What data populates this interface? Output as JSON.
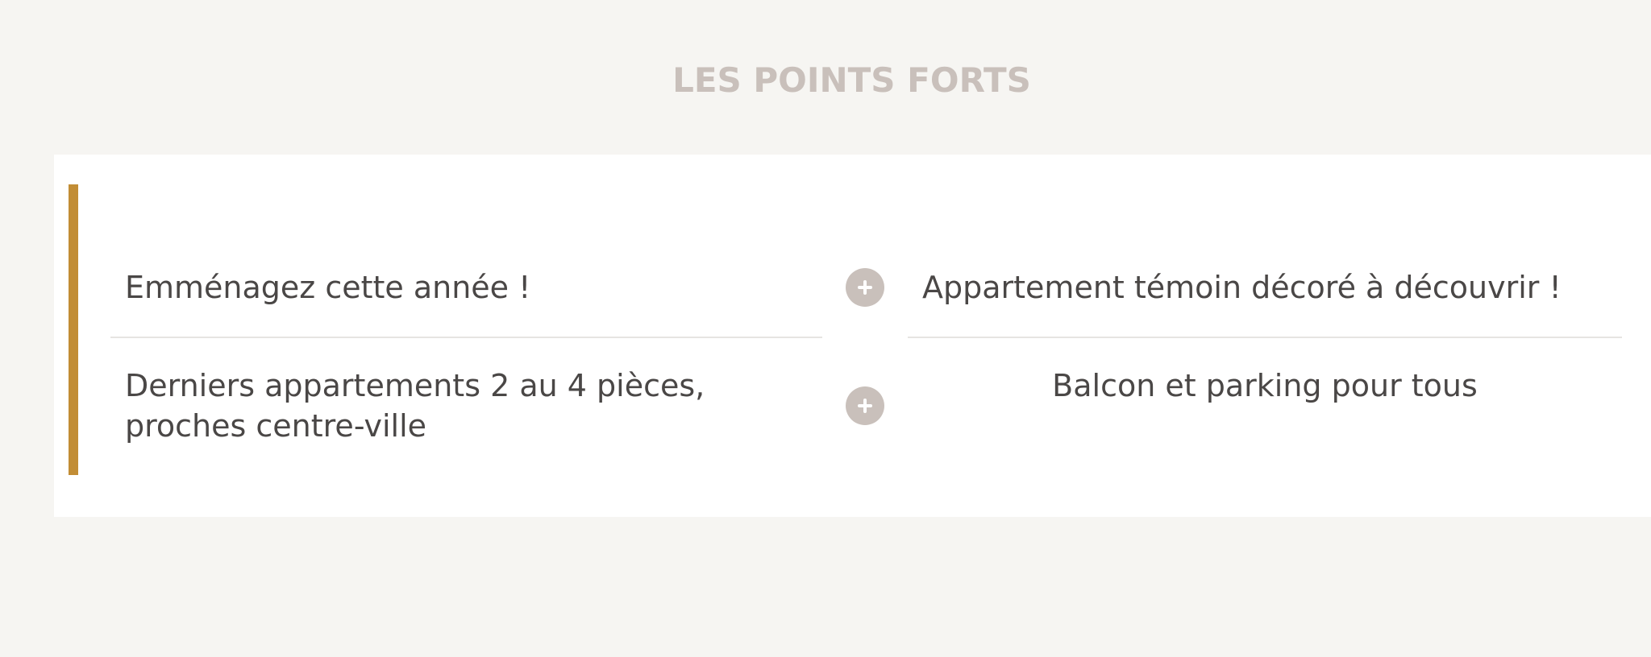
{
  "page": {
    "title": "LES POINTS FORTS"
  },
  "colors": {
    "background": "#f6f5f2",
    "card": "#ffffff",
    "accent": "#c28d35",
    "title": "#c9c0bb",
    "text": "#4a4746",
    "divider": "#e6e4e2",
    "plus_button": "#c9c0bb"
  },
  "highlights": {
    "items": [
      {
        "text": "Emménagez cette année !"
      },
      {
        "text": "Appartement témoin décoré à découvrir !"
      },
      {
        "lines": [
          "Derniers appartements 2 au 4 pièces,",
          "proches centre-ville"
        ]
      },
      {
        "text": "Balcon et parking pour tous"
      }
    ],
    "toggle_icon": "plus-icon"
  }
}
